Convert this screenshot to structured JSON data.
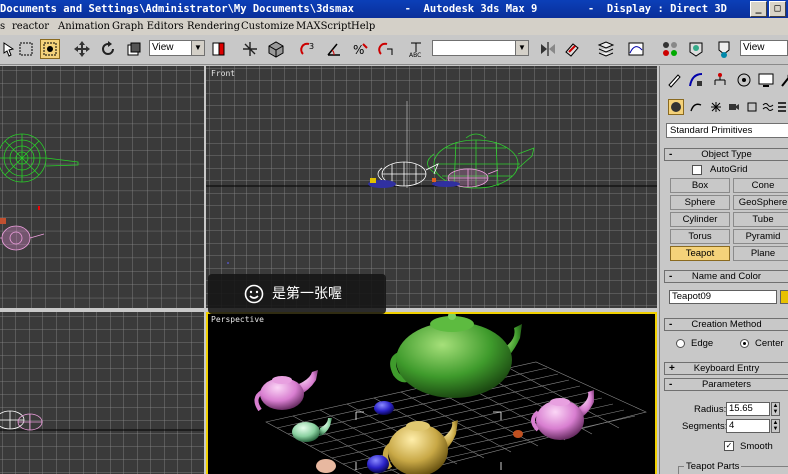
{
  "title": "Documents and Settings\\Administrator\\My Documents\\3dsmax        -  Autodesk 3ds Max 9        -  Display : Direct 3D",
  "menu": [
    "s",
    "reactor",
    "Animation",
    "Graph Editors",
    "Rendering",
    "Customize",
    "MAXScript",
    "Help"
  ],
  "toolbar": {
    "coord_view": "View",
    "selection_set": "",
    "right_view": "View"
  },
  "viewports": {
    "front_label": "Front",
    "perspective_label": "Perspective"
  },
  "toast": {
    "message": "是第一张喔"
  },
  "command_panel": {
    "dropdown_value": "Standard Primitives",
    "object_type": {
      "title": "Object Type",
      "autogrid_label": "AutoGrid",
      "buttons": [
        "Box",
        "Cone",
        "Sphere",
        "GeoSphere",
        "Cylinder",
        "Tube",
        "Torus",
        "Pyramid",
        "Teapot",
        "Plane"
      ],
      "active": "Teapot"
    },
    "name_color": {
      "title": "Name and Color",
      "name_value": "Teapot09",
      "swatch_color": "#e8c100"
    },
    "creation_method": {
      "title": "Creation Method",
      "edge_label": "Edge",
      "center_label": "Center",
      "selected": "Center"
    },
    "keyboard_entry": {
      "title": "Keyboard Entry",
      "sign": "+"
    },
    "parameters": {
      "title": "Parameters",
      "sign": "-",
      "radius_label": "Radius:",
      "radius_value": "15.65",
      "segments_label": "Segments:",
      "segments_value": "4",
      "smooth_label": "Smooth",
      "teapot_parts_label": "Teapot Parts"
    },
    "rollout_sign_minus": "-"
  },
  "colors": {
    "title_bar": "#0b3fb8",
    "active_yellow": "#f4d27a",
    "viewport_bg": "#3a3a3a",
    "grid": "#8a8a8a",
    "active_viewport_border": "#f0d000"
  }
}
